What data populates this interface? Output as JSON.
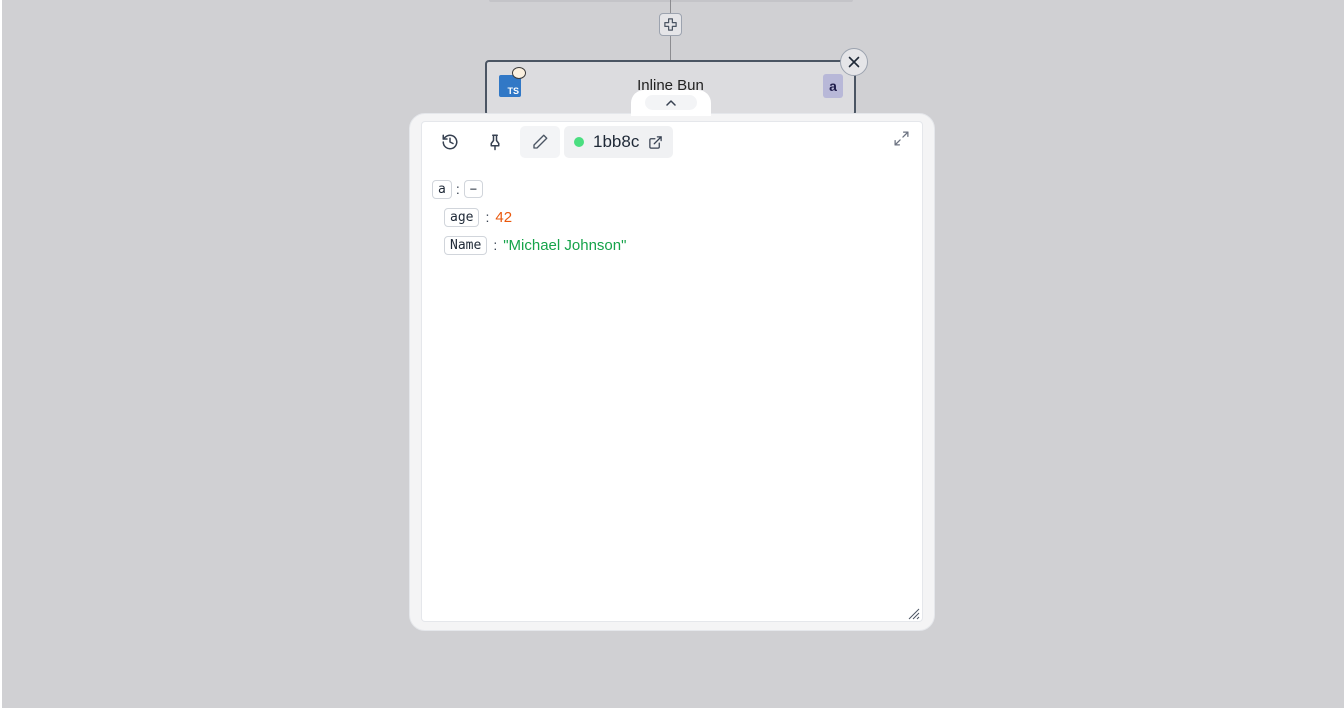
{
  "flow": {
    "add_step_icon": "plus-icon",
    "close_icon": "x-icon"
  },
  "node": {
    "title": "Inline Bun",
    "language_icon": "typescript-icon",
    "runtime_icon": "bun-icon",
    "language_label": "TS",
    "badge": "a"
  },
  "panel": {
    "collapse_icon": "chevron-up-icon",
    "toolbar": {
      "history_icon": "history-icon",
      "pin_icon": "pin-icon",
      "edit_icon": "pencil-icon",
      "job_id": "1bb8c",
      "job_status_color": "#4ade80",
      "open_icon": "external-link-icon",
      "expand_icon": "maximize-icon"
    },
    "result": {
      "root_key": "a",
      "collapse_label": "−",
      "fields": [
        {
          "key": "age",
          "value": "42",
          "type": "number"
        },
        {
          "key": "Name",
          "value": "\"Michael Johnson\"",
          "type": "string"
        }
      ]
    }
  },
  "colors": {
    "background": "#d0d0d3",
    "number": "#ea580c",
    "string": "#16a34a",
    "typescript": "#3178c6"
  }
}
